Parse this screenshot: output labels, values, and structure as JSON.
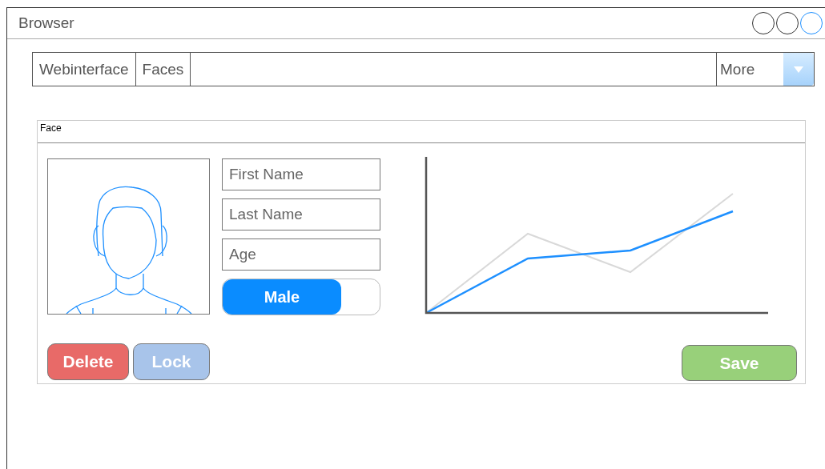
{
  "window": {
    "title": "Browser"
  },
  "nav": {
    "tabs": [
      {
        "label": "Webinterface"
      },
      {
        "label": "Faces"
      }
    ],
    "dropdown": {
      "value": "More"
    }
  },
  "panel": {
    "title": "Face",
    "fields": [
      {
        "placeholder": "First Name"
      },
      {
        "placeholder": "Last Name"
      },
      {
        "placeholder": "Age"
      }
    ],
    "toggle": {
      "label": "Male",
      "on": true
    },
    "buttons": [
      {
        "label": "Delete",
        "kind": "danger"
      },
      {
        "label": "Lock",
        "kind": "muted"
      },
      {
        "label": "Save",
        "kind": "success"
      }
    ]
  }
}
